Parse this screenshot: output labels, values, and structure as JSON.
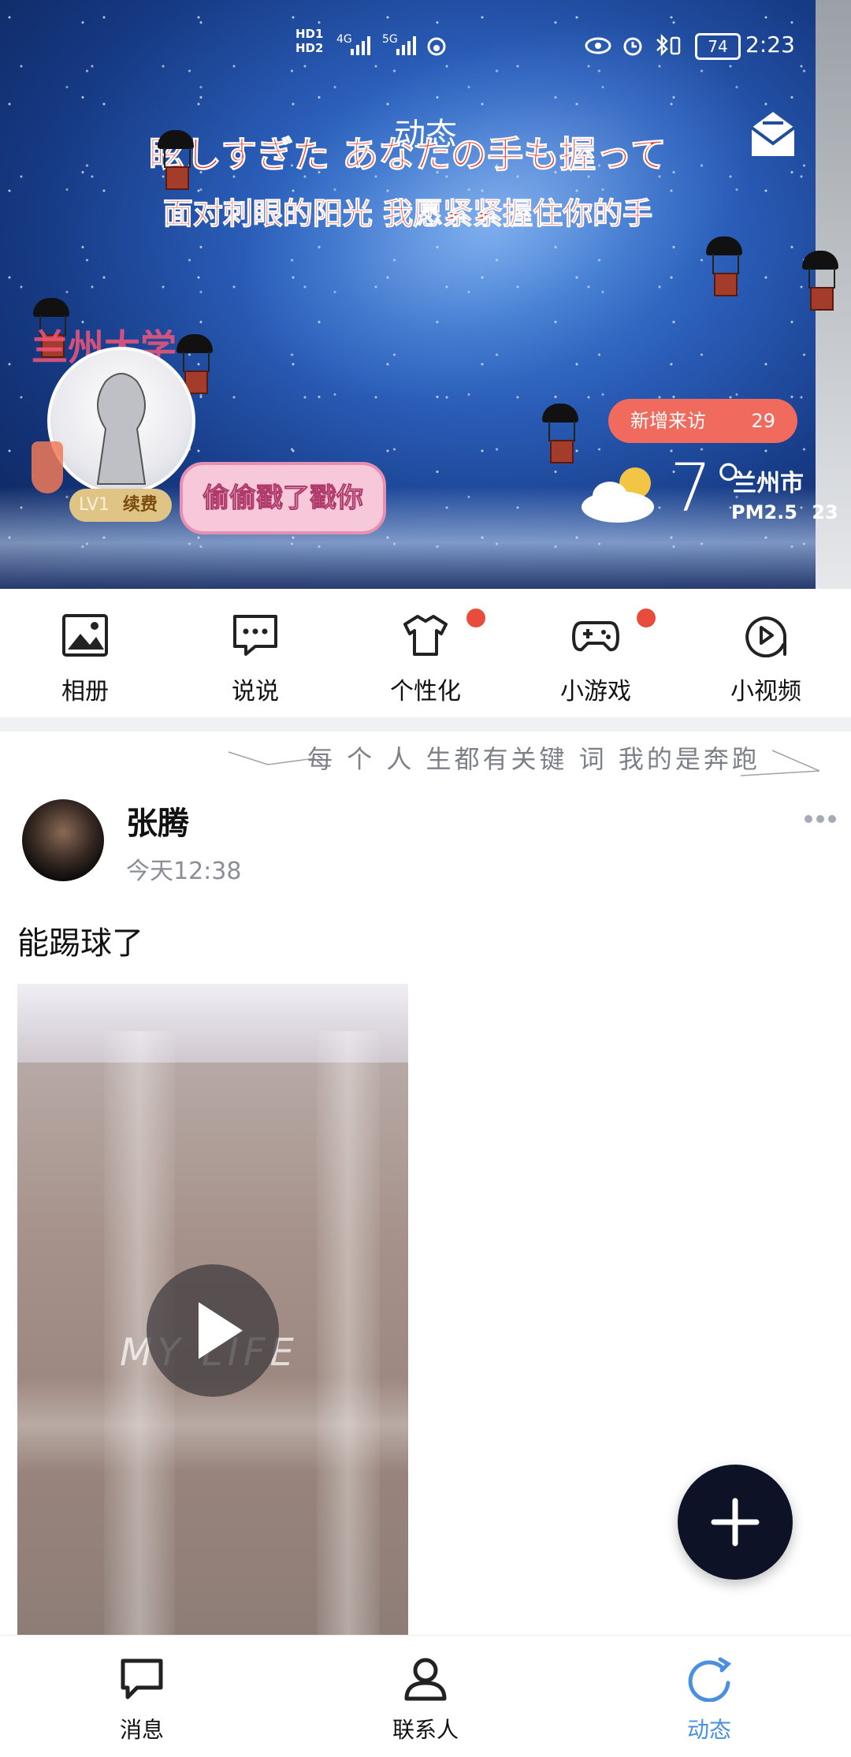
{
  "status_bar": {
    "hd1": "HD1",
    "hd2": "HD2",
    "signal1": "4G",
    "signal2": "5G",
    "battery": "74",
    "time": "2:23"
  },
  "header": {
    "title": "动态",
    "lyric_jp": "眩しすぎた あなたの手も握って",
    "lyric_cn": "面对刺眼的阳光 我愿紧紧握住你的手",
    "avatar_caption": "兰州大学",
    "level": "LV1",
    "renew": "续费",
    "poke_text": "偷偷戳了戳你",
    "visitors_label": "新增来访",
    "visitors_count": "29",
    "temperature": "7°",
    "city": "兰州市",
    "pm_label": "PM2.5",
    "pm_value": "23"
  },
  "quick_nav": [
    {
      "label": "相册",
      "icon": "album-icon",
      "badge": false
    },
    {
      "label": "说说",
      "icon": "chat-icon",
      "badge": false
    },
    {
      "label": "个性化",
      "icon": "tshirt-icon",
      "badge": true
    },
    {
      "label": "小游戏",
      "icon": "gamepad-icon",
      "badge": true
    },
    {
      "label": "小视频",
      "icon": "video-play-icon",
      "badge": false
    }
  ],
  "decor_banner": "每 个 人 生都有关键 词 我的是奔跑",
  "post": {
    "author": "张腾",
    "time": "今天12:38",
    "content": "能踢球了",
    "video_watermark": "MY LIFE"
  },
  "bottom_nav": [
    {
      "label": "消息",
      "icon": "message-icon",
      "active": false
    },
    {
      "label": "联系人",
      "icon": "contacts-icon",
      "active": false
    },
    {
      "label": "动态",
      "icon": "refresh-feed-icon",
      "active": true
    }
  ],
  "colors": {
    "accent_blue": "#4a90e2",
    "badge_red": "#e84c3d",
    "visitor_pill": "#f06a5e",
    "fab": "#0d1226"
  }
}
